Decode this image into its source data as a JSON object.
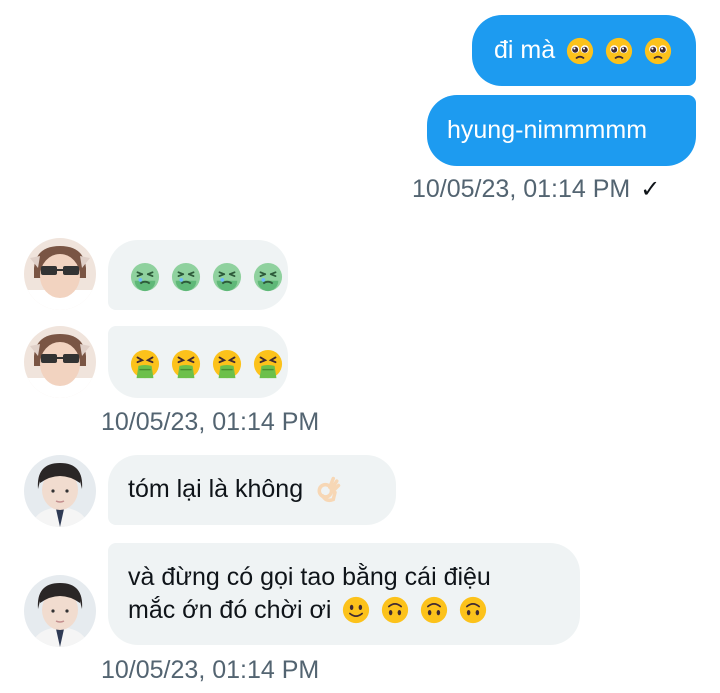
{
  "thread": {
    "outgoing": [
      {
        "text": "đi mà",
        "emoji": [
          "pleading-face",
          "pleading-face",
          "pleading-face"
        ]
      },
      {
        "text": "hyung-nimmmmm"
      }
    ],
    "outgoing_timestamp": "10/05/23, 01:14 PM",
    "read_mark": "✓",
    "incoming_group_1": [
      {
        "emoji": [
          "nauseated-face",
          "nauseated-face",
          "nauseated-face",
          "nauseated-face"
        ]
      },
      {
        "emoji": [
          "vomiting-face",
          "vomiting-face",
          "vomiting-face",
          "vomiting-face"
        ]
      }
    ],
    "incoming_group_1_timestamp": "10/05/23, 01:14 PM",
    "incoming_group_2": [
      {
        "text": "tóm lại là không",
        "emoji": [
          "ok-hand"
        ]
      },
      {
        "line1": "và đừng có gọi tao bằng cái điệu",
        "line2": "mắc ớn đó chời ơi",
        "emoji": [
          "slightly-smiling-face",
          "upside-down-face",
          "upside-down-face",
          "upside-down-face"
        ]
      }
    ],
    "incoming_group_2_timestamp": "10/05/23, 01:14 PM"
  },
  "colors": {
    "outgoing_bubble": "#1d9bf0",
    "incoming_bubble": "#eff3f4",
    "timestamp_text": "#536471"
  }
}
